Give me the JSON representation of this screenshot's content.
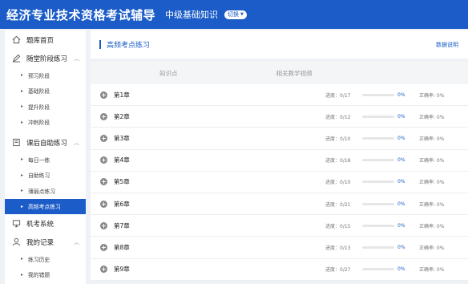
{
  "header": {
    "app_title": "经济专业技术资格考试辅导",
    "subject": "中级基础知识",
    "switch_label": "切换"
  },
  "sidebar": {
    "sections": [
      {
        "label": "题库首页",
        "icon": "home-icon"
      },
      {
        "label": "随堂阶段练习",
        "icon": "pen-icon",
        "items": [
          "预习阶段",
          "基础阶段",
          "提升阶段",
          "冲刺阶段"
        ]
      },
      {
        "label": "课后自助练习",
        "icon": "notebook-icon",
        "items": [
          "每日一练",
          "自助练习",
          "薄弱点练习",
          "高频考点练习"
        ]
      },
      {
        "label": "机考系统",
        "icon": "computer-icon"
      },
      {
        "label": "我的记录",
        "icon": "user-icon",
        "items": [
          "练习历史",
          "我的错题"
        ]
      }
    ],
    "active_item": "高频考点练习"
  },
  "main": {
    "title": "高频考点练习",
    "data_note": "数据说明",
    "columns": {
      "knowledge": "知识点",
      "video": "相关教学视频"
    },
    "progress_label": "进度：",
    "accuracy_label": "正确率: 0%",
    "rows": [
      {
        "chapter": "第1章",
        "progress": "0/17",
        "percent": "0%",
        "fill": 0
      },
      {
        "chapter": "第2章",
        "progress": "0/12",
        "percent": "0%",
        "fill": 0
      },
      {
        "chapter": "第3章",
        "progress": "0/10",
        "percent": "0%",
        "fill": 0
      },
      {
        "chapter": "第4章",
        "progress": "0/18",
        "percent": "0%",
        "fill": 0
      },
      {
        "chapter": "第5章",
        "progress": "0/10",
        "percent": "0%",
        "fill": 0
      },
      {
        "chapter": "第6章",
        "progress": "0/21",
        "percent": "0%",
        "fill": 0
      },
      {
        "chapter": "第7章",
        "progress": "0/15",
        "percent": "0%",
        "fill": 0
      },
      {
        "chapter": "第8章",
        "progress": "0/13",
        "percent": "0%",
        "fill": 0
      },
      {
        "chapter": "第9章",
        "progress": "0/27",
        "percent": "0%",
        "fill": 0
      }
    ]
  },
  "colors": {
    "brand": "#1b5cc8"
  }
}
